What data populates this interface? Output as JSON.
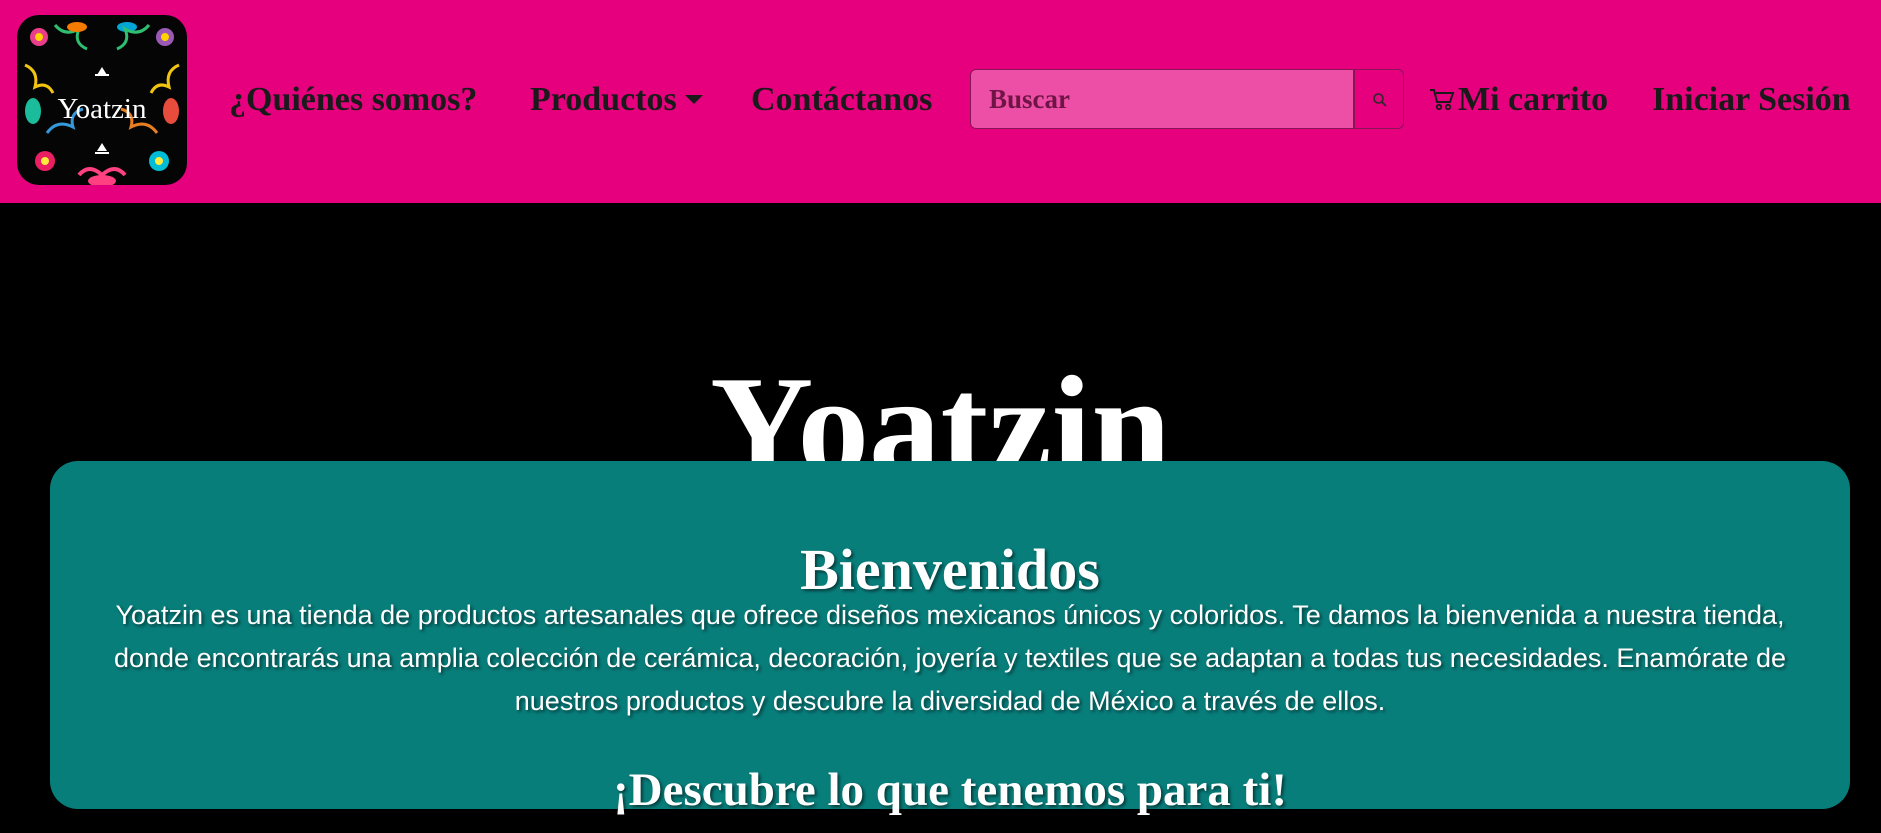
{
  "colors": {
    "navbar_bg": "#e6007e",
    "page_bg": "#000000",
    "card_bg": "#087e7b",
    "search_bg": "#ee4fa6",
    "text_light": "#ffffff",
    "text_dark": "#1a1a1a"
  },
  "logo": {
    "text": "Yoatzin",
    "icon": "floral-otomi-logo"
  },
  "nav": {
    "about": "¿Quiénes somos?",
    "products": "Productos",
    "contact": "Contáctanos",
    "cart": "Mi carrito",
    "login": "Iniciar Sesión"
  },
  "search": {
    "placeholder": "Buscar",
    "button_icon": "search-icon"
  },
  "hero": {
    "title": "Yoatzin"
  },
  "welcome": {
    "heading": "Bienvenidos",
    "text": "Yoatzin es una tienda de productos artesanales que ofrece diseños mexicanos únicos y coloridos. Te damos la bienvenida a nuestra tienda, donde encontrarás una amplia colección de cerámica, decoración, joyería y textiles que se adaptan a todas tus necesidades. Enamórate de nuestros productos y descubre la diversidad de México a través de ellos.",
    "subheading": "¡Descubre lo que tenemos para ti!"
  }
}
